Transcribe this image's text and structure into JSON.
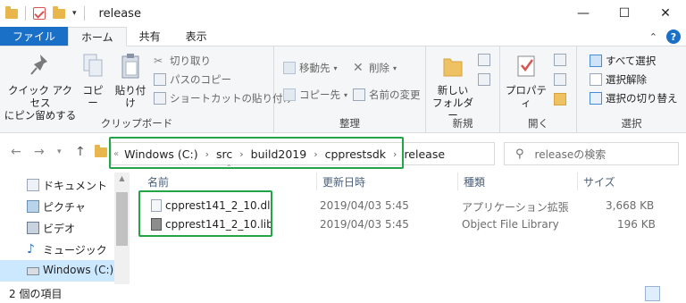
{
  "window": {
    "title": "release",
    "minimize": "—",
    "maximize": "☐",
    "close": "✕"
  },
  "ribbon_tabs": {
    "file": "ファイル",
    "home": "ホーム",
    "share": "共有",
    "view": "表示"
  },
  "ribbon": {
    "clipboard": {
      "pin": "クイック アクセス\nにピン留めする",
      "pin_line1": "クイック アクセス",
      "pin_line2": "にピン留めする",
      "copy": "コピー",
      "paste": "貼り付け",
      "cut": "切り取り",
      "copy_path": "パスのコピー",
      "paste_shortcut": "ショートカットの貼り付け",
      "label": "クリップボード"
    },
    "organize": {
      "move_to": "移動先",
      "copy_to": "コピー先",
      "delete": "削除",
      "rename": "名前の変更",
      "label": "整理"
    },
    "new": {
      "new_folder_line1": "新しい",
      "new_folder_line2": "フォルダー",
      "label": "新規"
    },
    "open": {
      "properties": "プロパティ",
      "label": "開く"
    },
    "select": {
      "select_all": "すべて選択",
      "select_none": "選択解除",
      "invert": "選択の切り替え",
      "label": "選択"
    }
  },
  "address": {
    "crumbs": [
      "Windows (C:)",
      "src",
      "build2019",
      "cpprestsdk",
      "release"
    ],
    "search_placeholder": "releaseの検索"
  },
  "nav": {
    "items": [
      {
        "label": "ドキュメント"
      },
      {
        "label": "ピクチャ"
      },
      {
        "label": "ビデオ"
      },
      {
        "label": "ミュージック"
      },
      {
        "label": "Windows (C:)"
      }
    ]
  },
  "columns": {
    "name": "名前",
    "modified": "更新日時",
    "type": "種類",
    "size": "サイズ"
  },
  "files": [
    {
      "name": "cpprest141_2_10.dll",
      "modified": "2019/04/03 5:45",
      "type": "アプリケーション拡張",
      "size": "3,668 KB"
    },
    {
      "name": "cpprest141_2_10.lib",
      "modified": "2019/04/03 5:45",
      "type": "Object File Library",
      "size": "196 KB"
    }
  ],
  "status": {
    "count": "2 個の項目"
  },
  "colors": {
    "accent": "#1a6fc6",
    "highlight_box": "#22a447",
    "selected_nav": "#cce8ff"
  }
}
